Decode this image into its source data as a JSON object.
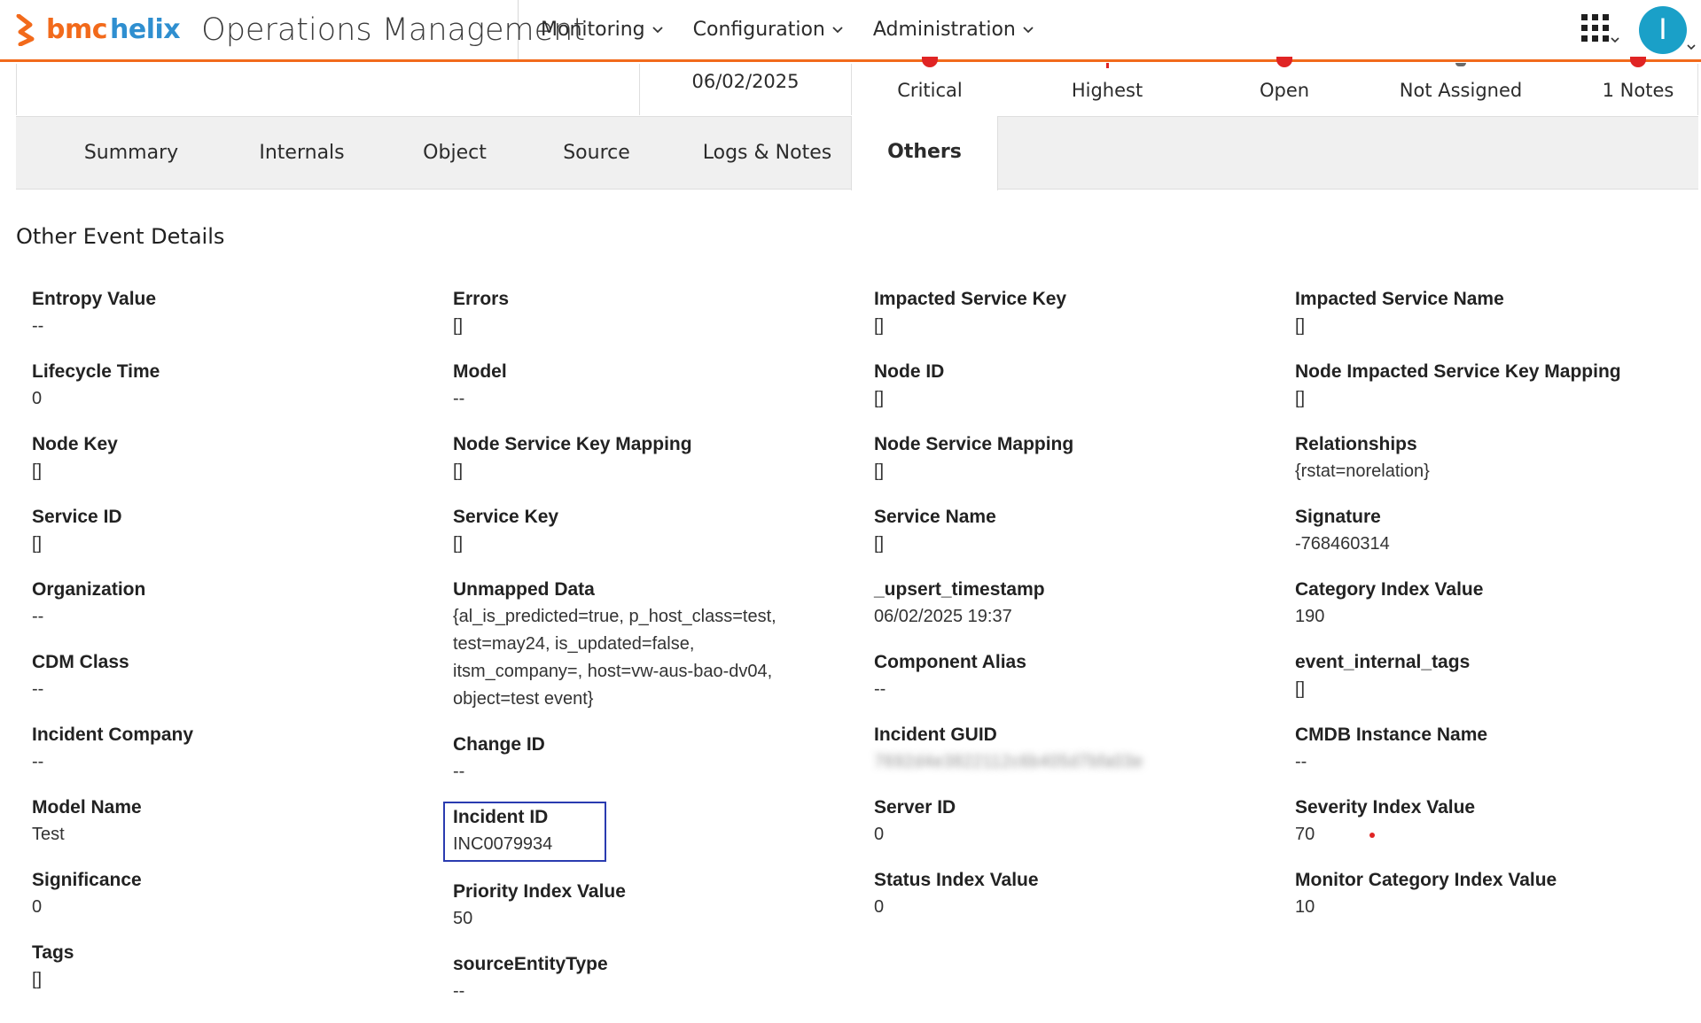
{
  "header": {
    "brand_bmc": "bmc",
    "brand_helix": "helix",
    "app_title": "Operations Management",
    "nav": [
      {
        "label": "Monitoring"
      },
      {
        "label": "Configuration"
      },
      {
        "label": "Administration"
      }
    ],
    "avatar_initial": "I",
    "accent_color": "#f26a1b"
  },
  "summary_strip": {
    "date": "06/02/2025",
    "severity": "Critical",
    "priority": "Highest",
    "status": "Open",
    "assignment": "Not Assigned",
    "notes": "1 Notes"
  },
  "tabs": [
    {
      "label": "Summary",
      "active": false
    },
    {
      "label": "Internals",
      "active": false
    },
    {
      "label": "Object",
      "active": false
    },
    {
      "label": "Source",
      "active": false
    },
    {
      "label": "Logs & Notes",
      "active": false
    },
    {
      "label": "Others",
      "active": true
    }
  ],
  "section_title": "Other Event Details",
  "columns": [
    [
      {
        "label": "Entropy Value",
        "value": "--"
      },
      {
        "label": "Lifecycle Time",
        "value": "0"
      },
      {
        "label": "Node Key",
        "value": "[]"
      },
      {
        "label": "Service ID",
        "value": "[]"
      },
      {
        "label": "Organization",
        "value": "--"
      },
      {
        "label": "CDM Class",
        "value": "--"
      },
      {
        "label": "Incident Company",
        "value": "--"
      },
      {
        "label": "Model Name",
        "value": "Test"
      },
      {
        "label": "Significance",
        "value": "0"
      },
      {
        "label": "Tags",
        "value": "[]"
      }
    ],
    [
      {
        "label": "Errors",
        "value": "[]"
      },
      {
        "label": "Model",
        "value": "--"
      },
      {
        "label": "Node Service Key Mapping",
        "value": "[]"
      },
      {
        "label": "Service Key",
        "value": "[]"
      },
      {
        "label": "Unmapped Data",
        "value": "{al_is_predicted=true, p_host_class=test,\ntest=may24, is_updated=false,\nitsm_company=, host=vw-aus-bao-dv04,\nobject=test event}"
      },
      {
        "label": "Change ID",
        "value": "--"
      },
      {
        "label": "Incident ID",
        "value": "INC0079934"
      },
      {
        "label": "Priority Index Value",
        "value": "50"
      },
      {
        "label": "sourceEntityType",
        "value": "--"
      }
    ],
    [
      {
        "label": "Impacted Service Key",
        "value": "[]"
      },
      {
        "label": "Node ID",
        "value": "[]"
      },
      {
        "label": "Node Service Mapping",
        "value": "[]"
      },
      {
        "label": "Service Name",
        "value": "[]"
      },
      {
        "label": "_upsert_timestamp",
        "value": "06/02/2025 19:37"
      },
      {
        "label": "Component Alias",
        "value": "--"
      },
      {
        "label": "Incident GUID",
        "value": "7692d4e3822112c6b405d7bfa03e"
      },
      {
        "label": "Server ID",
        "value": "0"
      },
      {
        "label": "Status Index Value",
        "value": "0"
      }
    ],
    [
      {
        "label": "Impacted Service Name",
        "value": "[]"
      },
      {
        "label": "Node Impacted Service Key Mapping",
        "value": "[]"
      },
      {
        "label": "Relationships",
        "value": "{rstat=norelation}"
      },
      {
        "label": "Signature",
        "value": "-768460314"
      },
      {
        "label": "Category Index Value",
        "value": "190"
      },
      {
        "label": "event_internal_tags",
        "value": "[]"
      },
      {
        "label": "CMDB Instance Name",
        "value": "--"
      },
      {
        "label": "Severity Index Value",
        "value": "70"
      },
      {
        "label": "Monitor Category Index Value",
        "value": "10"
      }
    ]
  ],
  "colors": {
    "severity_red": "#e02424",
    "highlight_box": "#2a3bb0",
    "avatar_bg": "#1aa0c8",
    "helix_blue": "#2f8fd0"
  }
}
